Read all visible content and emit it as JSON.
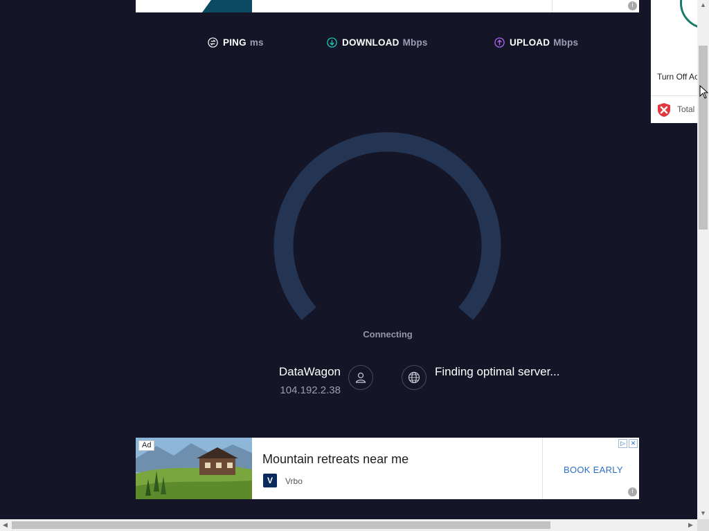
{
  "metrics": {
    "ping": {
      "label": "PING",
      "unit": "ms",
      "icon": "ping-icon",
      "color": "#ffffff"
    },
    "download": {
      "label": "DOWNLOAD",
      "unit": "Mbps",
      "icon": "download-arrow-icon",
      "color": "#1ad5c4"
    },
    "upload": {
      "label": "UPLOAD",
      "unit": "Mbps",
      "icon": "upload-arrow-icon",
      "color": "#b86cff"
    }
  },
  "gauge": {
    "status": "Connecting",
    "track_color": "#243554"
  },
  "provider": {
    "name": "DataWagon",
    "ip": "104.192.2.38"
  },
  "server": {
    "status": "Finding optimal server..."
  },
  "side_ad": {
    "turn_off_text": "Turn Off Ac",
    "product_text": "Total"
  },
  "bottom_ad": {
    "badge": "Ad",
    "headline": "Mountain retreats near me",
    "brand_logo_letter": "V",
    "brand": "Vrbo",
    "cta": "BOOK EARLY",
    "info": "i",
    "adchoices": [
      "▷",
      "✕"
    ]
  },
  "top_ad": {
    "info": "i"
  }
}
